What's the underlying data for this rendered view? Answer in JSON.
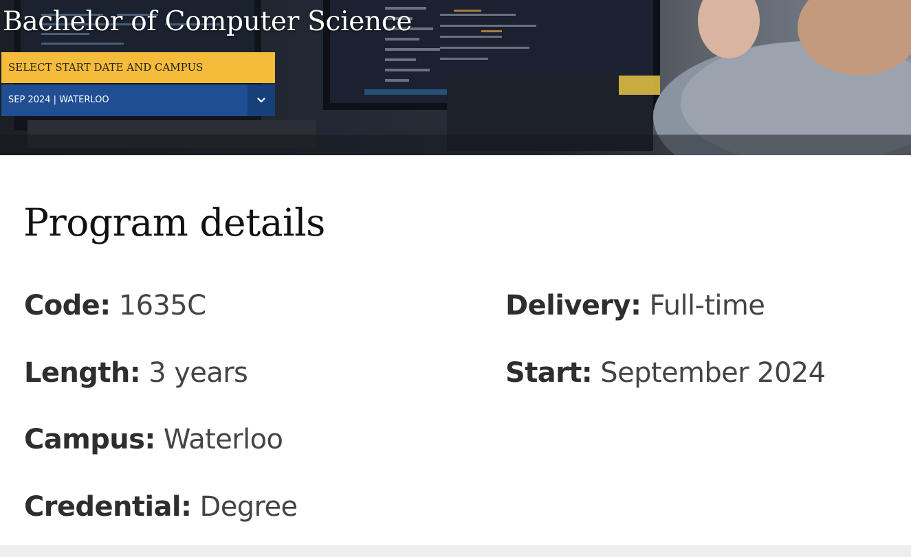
{
  "hero": {
    "title": "Bachelor of Computer Science",
    "select_label": "SELECT START DATE AND CAMPUS",
    "selected_option": "SEP 2024 | WATERLOO"
  },
  "program_details": {
    "title": "Program details",
    "code": {
      "label": "Code:",
      "value": "1635C"
    },
    "length": {
      "label": "Length:",
      "value": "3 years"
    },
    "campus": {
      "label": "Campus:",
      "value": "Waterloo"
    },
    "credential": {
      "label": "Credential:",
      "value": "Degree"
    },
    "delivery": {
      "label": "Delivery:",
      "value": "Full-time"
    },
    "start": {
      "label": "Start:",
      "value": "September 2024"
    }
  },
  "colors": {
    "accent_yellow": "#f5bb3a",
    "accent_blue": "#1f4e92"
  },
  "icons": {
    "dropdown": "chevron-down-icon"
  }
}
